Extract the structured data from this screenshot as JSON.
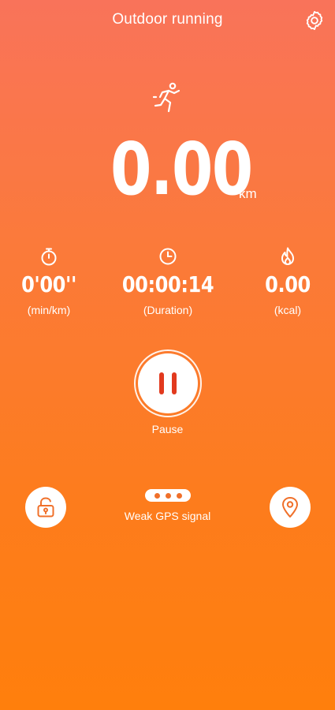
{
  "header": {
    "title": "Outdoor running",
    "settings_icon": "gear-icon"
  },
  "activity_icon": "running-person-icon",
  "distance": {
    "value": "0.00",
    "unit": "km"
  },
  "stats": [
    {
      "icon": "stopwatch-icon",
      "value": "0'00''",
      "label": "(min/km)"
    },
    {
      "icon": "clock-icon",
      "value": "00:00:14",
      "label": "(Duration)"
    },
    {
      "icon": "flame-icon",
      "value": "0.00",
      "label": "(kcal)"
    }
  ],
  "controls": {
    "pause_label": "Pause",
    "pause_icon": "pause-icon",
    "lock_icon": "lock-icon",
    "location_icon": "location-pin-icon"
  },
  "gps": {
    "status_text": "Weak GPS signal",
    "signal_dots": 3
  },
  "colors": {
    "gradient_top": "#f9735a",
    "gradient_bottom": "#ff7f0c",
    "accent_red": "#e23a1e",
    "foreground": "#ffffff"
  }
}
